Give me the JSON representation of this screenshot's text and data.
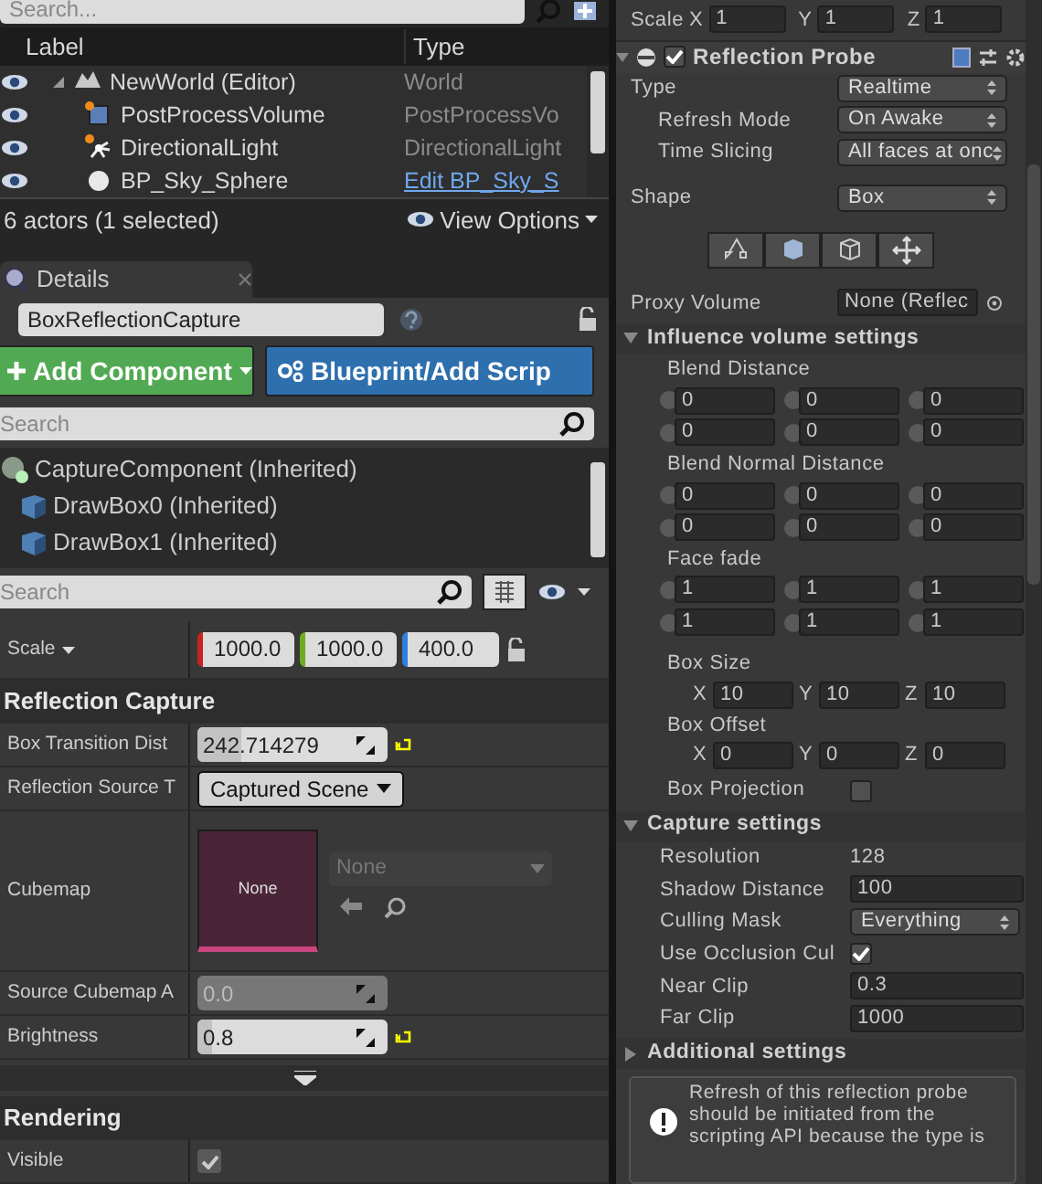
{
  "outliner": {
    "search_placeholder": "Search...",
    "columns": [
      "Label",
      "Type"
    ],
    "rows": [
      {
        "label": "NewWorld (Editor)",
        "type": "World",
        "kind": "world",
        "type_link": false
      },
      {
        "label": "PostProcessVolume",
        "type": "PostProcessVo",
        "kind": "volume",
        "type_link": false
      },
      {
        "label": "DirectionalLight",
        "type": "DirectionalLight",
        "kind": "light",
        "type_link": false
      },
      {
        "label": "BP_Sky_Sphere",
        "type": "Edit BP_Sky_S",
        "kind": "sphere",
        "type_link": true
      }
    ],
    "status": "6 actors (1 selected)",
    "view_options": "View Options"
  },
  "details": {
    "tab": "Details",
    "object_name": "BoxReflectionCapture",
    "add_component": "Add Component",
    "blueprint": "Blueprint/Add Scrip",
    "component_search_placeholder": "Search",
    "components": [
      {
        "label": "CaptureComponent (Inherited)",
        "kind": "capture"
      },
      {
        "label": "DrawBox0 (Inherited)",
        "kind": "box"
      },
      {
        "label": "DrawBox1 (Inherited)",
        "kind": "box"
      }
    ],
    "property_search_placeholder": "Search",
    "scale": {
      "label": "Scale",
      "values": [
        "1000.0",
        "1000.0",
        "400.0"
      ]
    },
    "sections": [
      {
        "title": "Reflection Capture",
        "properties": [
          {
            "label": "Box Transition Dist",
            "kind": "number",
            "value": "242.714279",
            "level": 0.23,
            "resettable": true,
            "disabled": false
          },
          {
            "label": "Reflection Source T",
            "kind": "dropdown",
            "value": "Captured Scene"
          },
          {
            "label": "Cubemap",
            "kind": "asset",
            "thumbnail": "None",
            "value": "None"
          },
          {
            "label": "Source Cubemap A",
            "kind": "number",
            "value": "0.0",
            "resettable": false,
            "disabled": true
          },
          {
            "label": "Brightness",
            "kind": "number",
            "value": "0.8",
            "level": 0.08,
            "resettable": true,
            "disabled": false
          }
        ]
      },
      {
        "title": "Rendering",
        "properties": [
          {
            "label": "Visible",
            "kind": "checkbox",
            "checked": true
          }
        ]
      }
    ]
  },
  "inspector": {
    "scale": {
      "label": "Scale",
      "axes": [
        {
          "axis": "X",
          "value": "1"
        },
        {
          "axis": "Y",
          "value": "1"
        },
        {
          "axis": "Z",
          "value": "1"
        }
      ]
    },
    "component": {
      "title": "Reflection Probe",
      "enabled": true
    },
    "probe_fields": [
      {
        "label": "Type",
        "kind": "dropdown",
        "value": "Realtime",
        "indented": false
      },
      {
        "label": "Refresh Mode",
        "kind": "dropdown",
        "value": "On Awake",
        "indented": true
      },
      {
        "label": "Time Slicing",
        "kind": "dropdown",
        "value": "All faces at onc",
        "indented": true
      },
      {
        "label": "Shape",
        "kind": "dropdown",
        "value": "Box",
        "indented": false
      }
    ],
    "proxy_volume": {
      "label": "Proxy Volume",
      "value": "None (Reflec"
    },
    "influence": {
      "title": "Influence volume settings",
      "expanded": true,
      "slider_groups": [
        {
          "label": "Blend Distance",
          "values": [
            "0",
            "0",
            "0",
            "0",
            "0",
            "0"
          ]
        },
        {
          "label": "Blend Normal Distance",
          "values": [
            "0",
            "0",
            "0",
            "0",
            "0",
            "0"
          ]
        },
        {
          "label": "Face fade",
          "values": [
            "1",
            "1",
            "1",
            "1",
            "1",
            "1"
          ]
        }
      ],
      "vectors": [
        {
          "label": "Box Size",
          "axes": [
            {
              "axis": "X",
              "value": "10"
            },
            {
              "axis": "Y",
              "value": "10"
            },
            {
              "axis": "Z",
              "value": "10"
            }
          ]
        },
        {
          "label": "Box Offset",
          "axes": [
            {
              "axis": "X",
              "value": "0"
            },
            {
              "axis": "Y",
              "value": "0"
            },
            {
              "axis": "Z",
              "value": "0"
            }
          ]
        }
      ],
      "box_projection": {
        "label": "Box Projection",
        "checked": false
      }
    },
    "capture": {
      "title": "Capture settings",
      "expanded": true,
      "fields": [
        {
          "label": "Resolution",
          "kind": "text",
          "value": "128"
        },
        {
          "label": "Shadow Distance",
          "kind": "field",
          "value": "100"
        },
        {
          "label": "Culling Mask",
          "kind": "dropdown",
          "value": "Everything"
        },
        {
          "label": "Use Occlusion Cul",
          "kind": "checkbox",
          "checked": true
        },
        {
          "label": "Near Clip",
          "kind": "field",
          "value": "0.3"
        },
        {
          "label": "Far Clip",
          "kind": "field",
          "value": "1000"
        }
      ]
    },
    "additional": {
      "title": "Additional settings",
      "expanded": false
    },
    "help": "Refresh of this reflection probe should be initiated from the scripting API because the type is"
  }
}
